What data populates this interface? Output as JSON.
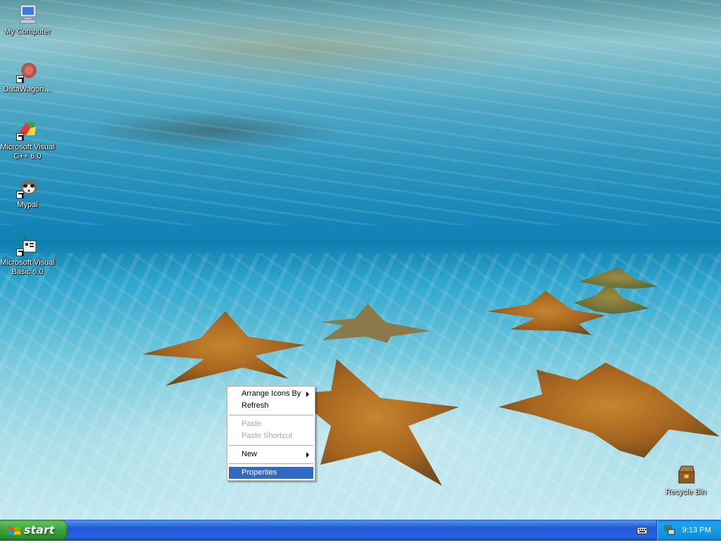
{
  "desktop": {
    "icons": [
      {
        "name": "my-computer",
        "label": "My Computer",
        "icon": "computer-icon"
      },
      {
        "name": "datawagon",
        "label": "DataWagon…",
        "icon": "datawagon-icon"
      },
      {
        "name": "ms-visual-cpp",
        "label": "Microsoft Visual C++ 6.0",
        "icon": "visual-cpp-icon"
      },
      {
        "name": "mypal",
        "label": "Mypal",
        "icon": "mypal-raccoon-icon"
      },
      {
        "name": "ms-visual-basic",
        "label": "Microsoft Visual Basic 6.0",
        "icon": "visual-basic-icon"
      },
      {
        "name": "recycle-bin",
        "label": "Recycle Bin",
        "icon": "recycle-bin-icon"
      }
    ],
    "wallpaper": "underwater starfish"
  },
  "context_menu": {
    "items": [
      {
        "label": "Arrange Icons By",
        "submenu": true,
        "enabled": true
      },
      {
        "label": "Refresh",
        "enabled": true
      },
      {
        "label": "Paste",
        "enabled": false
      },
      {
        "label": "Paste Shortcut",
        "enabled": false
      },
      {
        "label": "New",
        "submenu": true,
        "enabled": true
      },
      {
        "label": "Properties",
        "enabled": true,
        "highlighted": true
      }
    ]
  },
  "taskbar": {
    "start_label": "start",
    "clock": "9:13 PM",
    "tray_icons": [
      "keyboard-icon",
      "network-icon"
    ]
  },
  "colors": {
    "taskbar_blue": "#2663e0",
    "start_green": "#38a238",
    "menu_highlight": "#316ac5",
    "disabled_text": "#a7a6aa"
  }
}
